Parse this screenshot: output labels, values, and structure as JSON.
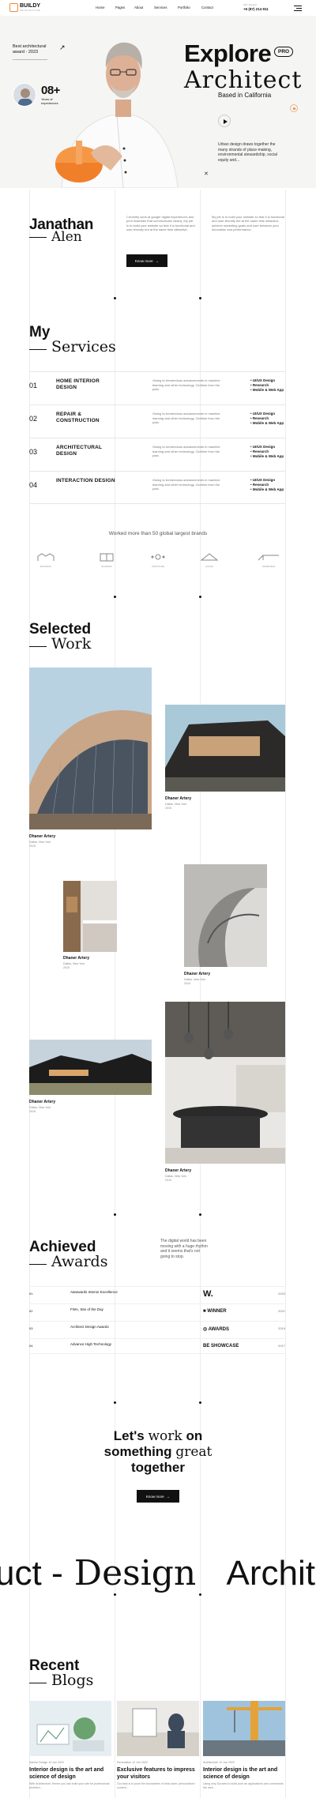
{
  "header": {
    "brand": "BUILDY",
    "brand_sub": "ARCHITECTURE",
    "nav": [
      {
        "label": "Home"
      },
      {
        "label": "Pages"
      },
      {
        "label": "About"
      },
      {
        "label": "Services"
      },
      {
        "label": "Portfolio"
      },
      {
        "label": "Contact"
      }
    ],
    "support_label": "24/7 Support",
    "phone": "+6 (87) 214 911"
  },
  "hero": {
    "award_line1": "Best architectural",
    "award_line2": "award - 2023",
    "stat_number": "08+",
    "stat_label_line1": "Years of",
    "stat_label_line2": "experiences",
    "title_line1": "Explore",
    "badge": "PRO",
    "title_line2": "Architect",
    "location": "Based in California",
    "quote": "Urban design draws together the many strands of place-making, environmental stewardship, social equity and...",
    "close_glyph": "✕"
  },
  "about": {
    "name_first": "Janathan",
    "name_last": "Alen",
    "para1": "Currently work at google digital experiences and print materials that communicate clearly. My job is to build your website so that it is functional and user-friendly but at the same time attractive.",
    "para2": "My job is to build your website so that it is functional and user-friendly but at the same time attractive. achieve marketing goals and user between your innovation and performance.",
    "button": "Know more"
  },
  "services": {
    "title_bold": "My",
    "title_serif": "Services",
    "items": [
      {
        "num": "01",
        "title": "HOME INTERIOR DESIGN",
        "desc": "Owing to tremendous advancements in machine learning and other technology. Clothine from the past.",
        "tags": [
          "UI/UX Design",
          "Research",
          "Mobile & Web App"
        ]
      },
      {
        "num": "02",
        "title": "REPAIR & CONSTRUCTION",
        "desc": "Owing to tremendous advancements in machine learning and other technology. Clothine from the past.",
        "tags": [
          "UI/UX Design",
          "Research",
          "Mobile & Web App"
        ]
      },
      {
        "num": "03",
        "title": "ARCHITECTURAL DESIGN",
        "desc": "Owing to tremendous advancements in machine learning and other technology. Clothine from the past.",
        "tags": [
          "UI/UX Design",
          "Research",
          "Mobile & Web App"
        ]
      },
      {
        "num": "04",
        "title": "INTERACTION DESIGN",
        "desc": "Owing to tremendous advancements in machine learning and other technology. Clothine from the past.",
        "tags": [
          "UI/UX Design",
          "Research",
          "Mobile & Web App"
        ]
      }
    ]
  },
  "brands": {
    "heading": "Worked more than 50 global largest brands",
    "items": [
      "BUILDINGS",
      "BUILDERS",
      "STRUCTURE",
      "HOUSE",
      "HOMESTEAD"
    ]
  },
  "work": {
    "title_bold": "Selected",
    "title_serif": "Work",
    "items": [
      {
        "name": "Dhaner Artery",
        "sub1": "Dallas, New York",
        "sub2": "2015"
      },
      {
        "name": "Dhaner Artery",
        "sub1": "Dallas, New York",
        "sub2": "2015"
      },
      {
        "name": "Dhaner Artery",
        "sub1": "Dallas, New York",
        "sub2": "2015"
      },
      {
        "name": "Dhaner Artery",
        "sub1": "Dallas, New York",
        "sub2": "2015"
      },
      {
        "name": "Dhaner Artery",
        "sub1": "Dallas, New York",
        "sub2": "2015"
      },
      {
        "name": "Dhaner Artery",
        "sub1": "Dallas, New York",
        "sub2": "2015"
      }
    ]
  },
  "awards": {
    "title_bold": "Achieved",
    "title_serif": "Awards",
    "intro": "The digital world has been moving with a huge rhythm and it seems that's not going to stop.",
    "items": [
      {
        "num": "01",
        "title": "Awwwards Interior Excellence",
        "logo": "W.",
        "year": "2020"
      },
      {
        "num": "02",
        "title": "FWA, Site of the Day",
        "logo": "■ WINNER",
        "year": "2021"
      },
      {
        "num": "03",
        "title": "Architect Design Awards",
        "logo": "◎ AWARDS",
        "year": "2019"
      },
      {
        "num": "04",
        "title": "Advance High Technology",
        "logo": "BE SHOWCASE",
        "year": "2017"
      }
    ]
  },
  "cta": {
    "line1_a": "Let's",
    "line1_b": "work",
    "line1_c": "on",
    "line2_a": "something",
    "line2_b": "great",
    "line3": "together",
    "button": "Know more"
  },
  "marquee": {
    "part1": "uct",
    "sep": "- Design",
    "part2": "Archite"
  },
  "blogs": {
    "title_bold": "Recent",
    "title_serif": "Blogs",
    "items": [
      {
        "meta": "Interior Design  12 Jun 2022",
        "title": "Interior design is the art and science of design",
        "excerpt": "With Architecture, theme you can build your site for professional architect..."
      },
      {
        "meta": "Renovation  12 Jun 2022",
        "title": "Exclusive features to impress your visitors",
        "excerpt": "Our task is to push the boundaries of brick-laser, personalized content..."
      },
      {
        "meta": "Architecture  12 Jun 2022",
        "title": "Interior design is the art and science of design",
        "excerpt": "Using only Duratec to build pure an applications and commands the web..."
      }
    ]
  },
  "colors": {
    "accent": "#f08a3a",
    "dark": "#111111"
  }
}
